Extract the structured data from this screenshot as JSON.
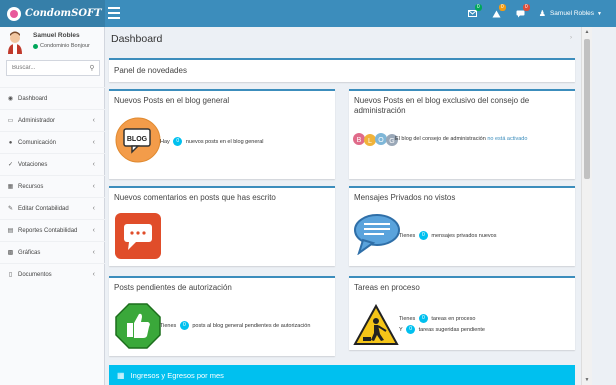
{
  "app": {
    "logo": "CondomSOFT"
  },
  "topbar": {
    "notifications": [
      {
        "icon": "envelope-icon",
        "count": "0",
        "color": "#00a65a"
      },
      {
        "icon": "warning-icon",
        "count": "0",
        "color": "#f39c12"
      },
      {
        "icon": "comments-icon",
        "count": "0",
        "color": "#dd4b39"
      }
    ],
    "user": "Samuel Robles"
  },
  "sidebar": {
    "user_name": "Samuel Robles",
    "user_condo": "Condominio Bonjour",
    "search_placeholder": "Buscar...",
    "items": [
      {
        "label": "Dashboard",
        "icon": "dashboard-icon",
        "chevron": ""
      },
      {
        "label": "Administrador",
        "icon": "laptop-icon",
        "chevron": "‹"
      },
      {
        "label": "Comunicación",
        "icon": "comments-icon",
        "chevron": "‹"
      },
      {
        "label": "Votaciones",
        "icon": "check-icon",
        "chevron": "‹"
      },
      {
        "label": "Recursos",
        "icon": "calendar-icon",
        "chevron": "‹"
      },
      {
        "label": "Editar Contabilidad",
        "icon": "pencil-icon",
        "chevron": "‹"
      },
      {
        "label": "Reportes Contabilidad",
        "icon": "report-icon",
        "chevron": "‹"
      },
      {
        "label": "Gráficas",
        "icon": "chart-icon",
        "chevron": "‹"
      },
      {
        "label": "Documentos",
        "icon": "folder-icon",
        "chevron": "‹"
      }
    ]
  },
  "main": {
    "title": "Dashboard",
    "panel_title": "Panel de novedades",
    "boxes": {
      "blog": {
        "title": "Nuevos Posts en el blog general",
        "pre": "Hay",
        "count": "0",
        "post": "nuevos posts en el blog general",
        "icon_text": "BLOG"
      },
      "blog_consejo": {
        "title": "Nuevos Posts en el blog exclusivo del consejo de administración",
        "text": "El blog del consejo de administración",
        "link": "no está activado"
      },
      "comments": {
        "title": "Nuevos comentarios en posts que has escrito"
      },
      "messages": {
        "title": "Mensajes Privados no vistos",
        "pre": "Tienes",
        "count": "0",
        "post": "mensajes privados nuevos"
      },
      "pending": {
        "title": "Posts pendientes de autorización",
        "pre": "Tienes",
        "count": "0",
        "post": "posts al blog general pendientes de autorización"
      },
      "tasks": {
        "title": "Tareas en proceso",
        "line1_pre": "Tienes",
        "line1_count": "0",
        "line1_post": "tareas en proceso",
        "line2_pre": "Y",
        "line2_count": "0",
        "line2_post": "tareas sugeridas pendiente"
      }
    },
    "bottom_bar": "Ingresos y Egresos por mes"
  }
}
